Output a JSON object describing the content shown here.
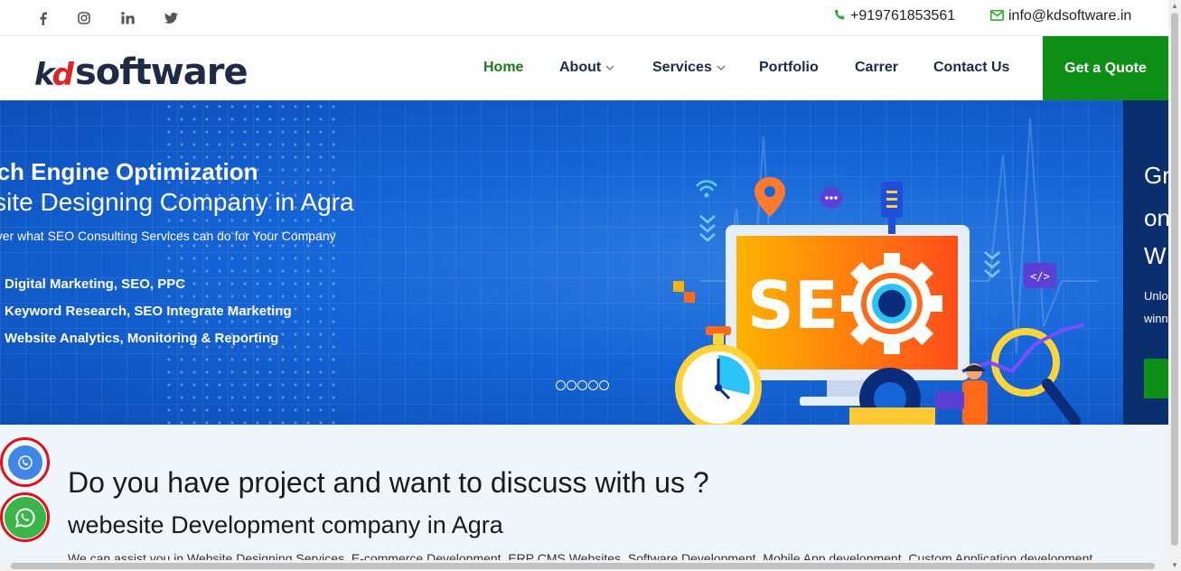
{
  "topbar": {
    "social": [
      {
        "name": "facebook-icon",
        "glyph": "f"
      },
      {
        "name": "instagram-icon",
        "glyph": "◎"
      },
      {
        "name": "linkedin-icon",
        "glyph": "in"
      },
      {
        "name": "twitter-icon",
        "glyph": "🐦"
      }
    ],
    "phone": "+919761853561",
    "email": "info@kdsoftware.in"
  },
  "logo": {
    "kd": "kd",
    "software": "software"
  },
  "nav": {
    "items": [
      {
        "label": "Home",
        "active": true
      },
      {
        "label": "About",
        "dropdown": true
      },
      {
        "label": "Services",
        "dropdown": true
      },
      {
        "label": "Portfolio"
      },
      {
        "label": "Carrer"
      },
      {
        "label": "Contact Us"
      }
    ],
    "cta": "Get a Quote"
  },
  "hero": {
    "heading": "arch Engine Optimization",
    "title": "ebsite Designing Company in Agra",
    "subtitle": "over what SEO Consulting Services can do for Your Company",
    "bullets": [
      "Digital Marketing, SEO, PPC",
      "Keyword Research, SEO Integrate Marketing",
      "Website Analytics, Monitoring & Reporting"
    ],
    "illustration_text": "SEO",
    "pager_count": 5,
    "next_slide": {
      "lines": [
        "Gr",
        "on",
        "W"
      ],
      "small": [
        "Unlo",
        "winn"
      ]
    }
  },
  "discuss": {
    "heading": "Do you have project and want to discuss with us ?",
    "subheading": "webesite Development company in Agra",
    "text": "We can assist you in Website Designing Services, E-commerce Development, ERP CMS Websites, Software Development, Mobile App development, Custom Application development"
  },
  "floating": {
    "call_icon": "phone-icon",
    "whatsapp_icon": "whatsapp-icon"
  },
  "colors": {
    "brand_green": "#0d8f16",
    "hero_blue": "#1565d8",
    "navy": "#1c2b4a",
    "red_ring": "#e0101a"
  }
}
